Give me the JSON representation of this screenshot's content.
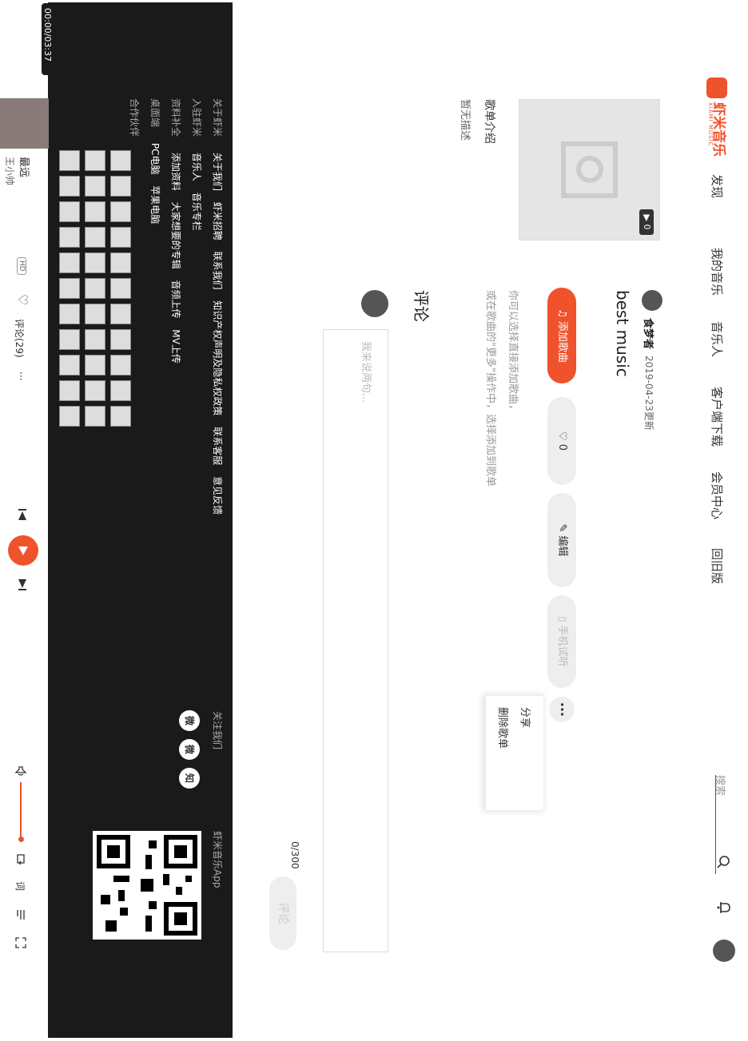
{
  "header": {
    "logo_text": "虾米音乐",
    "logo_sub": "XIAMI MUSIC",
    "nav": [
      "发现",
      "我的音乐",
      "音乐人",
      "客户端下载",
      "会员中心",
      "回旧版"
    ],
    "search_placeholder": "搜索"
  },
  "playlist": {
    "cover_count": "0",
    "title": "best music",
    "creator": "食梦者",
    "updated": "2019-04-23更新",
    "hint1": "你可以选择直接添加歌曲，",
    "hint2": "或在歌曲的\"更多\"操作中，选择添加到歌单",
    "intro_title": "歌单介绍",
    "intro_text": "暂无描述"
  },
  "buttons": {
    "add": "添加歌曲",
    "fav": "0",
    "edit": "编辑",
    "trial": "手机试听",
    "more": "···"
  },
  "menu": {
    "share": "分享",
    "delete": "删除歌单"
  },
  "comments": {
    "title": "评论",
    "placeholder": "我来说两句...",
    "count": "0/300",
    "submit": "评论"
  },
  "footer": {
    "rows": [
      {
        "label": "关于虾米",
        "links": [
          "关于我们",
          "虾米招聘",
          "联系我们",
          "知识产权声明及隐私权政策",
          "联系客服",
          "意见反馈"
        ]
      },
      {
        "label": "入驻虾米",
        "links": [
          "音乐人",
          "音乐专栏"
        ]
      },
      {
        "label": "资料补全",
        "links": [
          "添加资料",
          "大家想要的专辑",
          "音频上传",
          "MV上传"
        ]
      },
      {
        "label": "桌面端",
        "links": [
          "PC电脑",
          "苹果电脑"
        ]
      },
      {
        "label": "合作伙伴",
        "links": []
      }
    ],
    "follow_label": "关注我们",
    "social": [
      "微",
      "微",
      "知"
    ],
    "app_label": "虾米音乐App"
  },
  "player": {
    "time": "00:00/03:37",
    "song": "最远",
    "artist": "王小帅",
    "quality": "HD",
    "comments": "评论(29)",
    "more": "···",
    "lyrics": "词"
  }
}
